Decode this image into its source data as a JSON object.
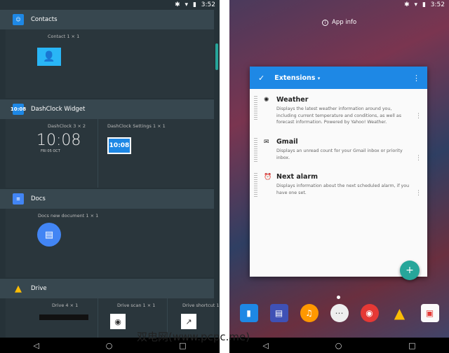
{
  "status": {
    "time": "3:52",
    "bt_icon": "bluetooth-icon",
    "wifi_icon": "wifi-icon",
    "battery_icon": "battery-icon"
  },
  "widgets": {
    "sections": [
      {
        "name": "Contacts",
        "icon": "contacts-icon",
        "color": "#1e88e5",
        "items": [
          {
            "label": "Contact 1 × 1"
          }
        ]
      },
      {
        "name": "DashClock Widget",
        "icon": "dashclock-icon",
        "color": "#1e88e5",
        "icon_text": "10:08",
        "items": [
          {
            "label": "DashClock 3 × 2",
            "clock": "10:08",
            "date": "FRI 05 OCT"
          },
          {
            "label": "DashClock Settings 1 × 1",
            "clock": "10:08"
          }
        ]
      },
      {
        "name": "Docs",
        "icon": "docs-icon",
        "color": "#4285f4",
        "items": [
          {
            "label": "Docs new document 1 × 1"
          }
        ]
      },
      {
        "name": "Drive",
        "icon": "drive-icon",
        "color": "#fbbc05",
        "items": [
          {
            "label": "Drive 4 × 1"
          },
          {
            "label": "Drive scan 1 × 1"
          },
          {
            "label": "Drive shortcut 1"
          }
        ]
      }
    ]
  },
  "launcher": {
    "app_info": "App info",
    "card": {
      "title": "Extensions",
      "extensions": [
        {
          "name": "Weather",
          "icon": "sun-icon",
          "desc": "Displays the latest weather information around you, including current temperature and conditions, as well as forecast information. Powered by Yahoo! Weather."
        },
        {
          "name": "Gmail",
          "icon": "mail-icon",
          "desc": "Displays an unread count for your Gmail inbox or priority inbox."
        },
        {
          "name": "Next alarm",
          "icon": "alarm-icon",
          "desc": "Displays information about the next scheduled alarm, if you have one set."
        }
      ]
    },
    "dock": [
      "books-icon",
      "newsstand-icon",
      "music-icon",
      "apps-drawer-icon",
      "chrome-icon",
      "drive-icon",
      "photo-icon"
    ]
  },
  "watermark": "双电网(www.pcpc.me)"
}
